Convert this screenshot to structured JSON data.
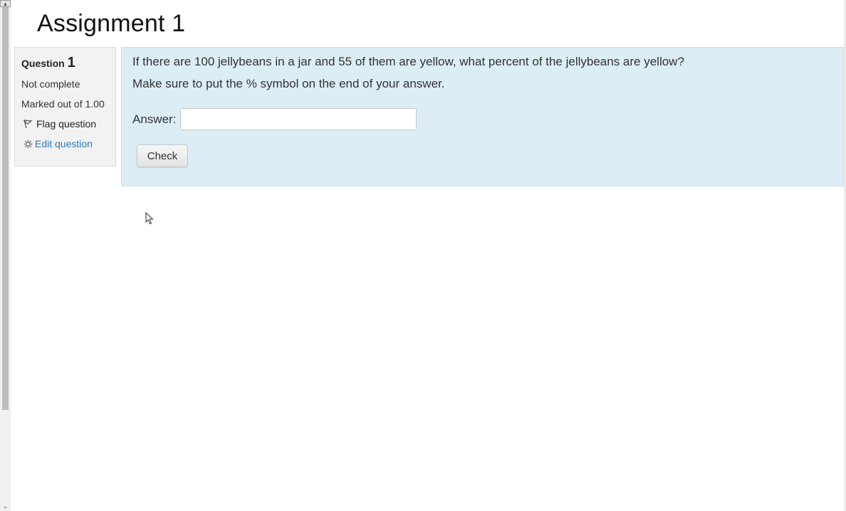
{
  "page": {
    "title": "Assignment 1"
  },
  "info": {
    "question_word": "Question",
    "question_number": "1",
    "status": "Not complete",
    "marks": "Marked out of 1.00",
    "flag_label": "Flag question",
    "edit_label": "Edit question"
  },
  "question": {
    "text_line1": "If there are 100 jellybeans in a jar and 55 of them are yellow, what percent of the jellybeans are yellow?",
    "text_line2": "Make sure to put the % symbol on the end of your answer.",
    "answer_label": "Answer:",
    "answer_value": "",
    "check_label": "Check"
  },
  "icons": {
    "flag": "flag-icon",
    "gear": "gear-icon",
    "cursor": "mouse-pointer-icon"
  },
  "colors": {
    "content_bg": "#dcedf5",
    "info_bg": "#f2f2f2",
    "link": "#2e7bb4"
  }
}
